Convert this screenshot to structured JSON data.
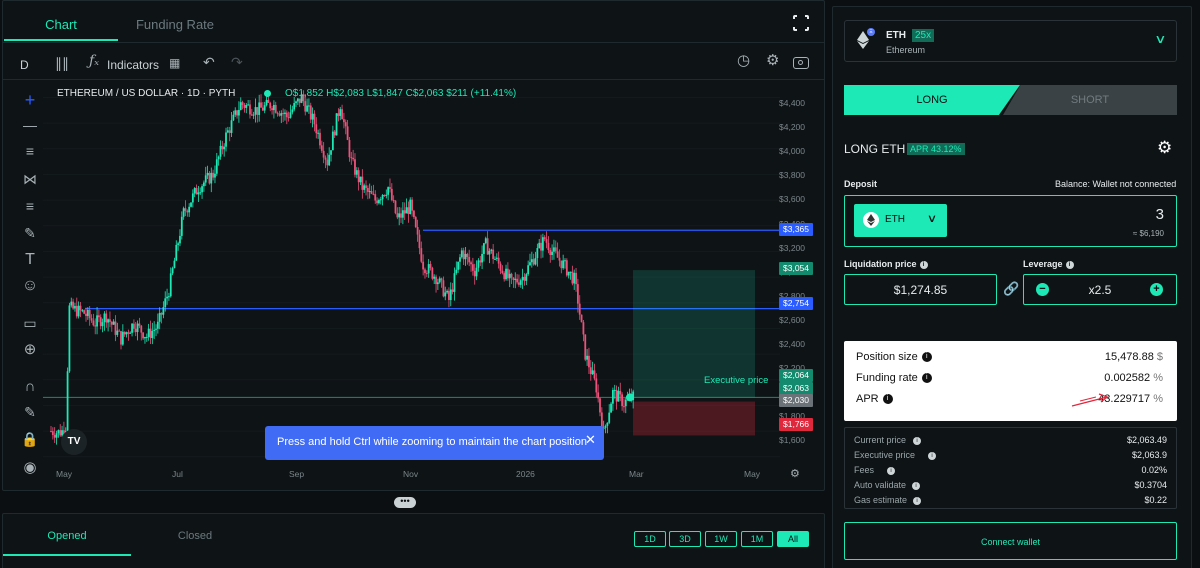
{
  "chart_tabs": [
    "Chart",
    "Funding Rate"
  ],
  "toolbar": {
    "interval": "D",
    "indicators_label": "Indicators"
  },
  "legend": {
    "symbol": "ETHEREUM / US DOLLAR · 1D · PYTH",
    "ohlc": "O$1,852 H$2,083 L$1,847 C$2,063 $211 (+11.41%)"
  },
  "price_axis": [
    "$4,400",
    "$4,200",
    "$4,000",
    "$3,800",
    "$3,600",
    "$3,400",
    "$3,200",
    "$3,000",
    "$2,800",
    "$2,600",
    "$2,400",
    "$2,200",
    "$2,000",
    "$1,800",
    "$1,600"
  ],
  "price_tags": [
    {
      "text": "$3,365",
      "color": "#2a5cff"
    },
    {
      "text": "$3,054",
      "color": "#138a6d"
    },
    {
      "text": "$2,754",
      "color": "#2a5cff"
    },
    {
      "text": "$2,064",
      "color": "#138a6d"
    },
    {
      "text": "$2,063",
      "color": "#138a6d"
    },
    {
      "text": "$2,030",
      "color": "#6b7378"
    },
    {
      "text": "$1,766",
      "color": "#e0283c"
    }
  ],
  "x_axis": [
    "May",
    "Jul",
    "Sep",
    "Nov",
    "2026",
    "Mar",
    "May"
  ],
  "executive_price_label": "Executive price",
  "tooltip": "Press and hold Ctrl while zooming to maintain the chart position",
  "bottom": {
    "tabs": [
      "Opened",
      "Closed"
    ],
    "ranges": [
      "1D",
      "3D",
      "1W",
      "1M",
      "All"
    ],
    "active_range": "All"
  },
  "asset": {
    "symbol": "ETH",
    "leverage_badge": "25x",
    "name": "Ethereum"
  },
  "side_tabs": {
    "long": "LONG",
    "short": "SHORT"
  },
  "position_title": "LONG ETH",
  "apr_badge": "APR 43.12%",
  "deposit": {
    "label": "Deposit",
    "balance": "Balance: Wallet not connected",
    "token": "ETH",
    "amount": "3",
    "usd": "≈ $6,190"
  },
  "liquidation": {
    "label": "Liquidation price",
    "value": "$1,274.85"
  },
  "leverage": {
    "label": "Leverage",
    "value": "x2.5"
  },
  "summary": [
    {
      "label": "Position size",
      "value": "15,478.88",
      "unit": "$"
    },
    {
      "label": "Funding rate",
      "value": "0.002582",
      "unit": "%"
    },
    {
      "label": "APR",
      "value": "43.229717",
      "unit": "%"
    }
  ],
  "details": [
    {
      "label": "Current price",
      "value": "$2,063.49"
    },
    {
      "label": "Executive price",
      "value": "$2,063.9"
    },
    {
      "label": "Fees",
      "value": "0.02%"
    },
    {
      "label": "Auto validate",
      "value": "$0.3704"
    },
    {
      "label": "Gas estimate",
      "value": "$0.22"
    }
  ],
  "connect_wallet": "Connect wallet",
  "colors": {
    "accent": "#1de9b6",
    "bull": "#1de9b6",
    "bear": "#f0517a",
    "line": "#2a5cff",
    "bg": "#0b0f12"
  },
  "chart_data": {
    "type": "candlestick",
    "title": "ETHEREUM / US DOLLAR · 1D · PYTH",
    "y_ticks": [
      4400,
      4200,
      4000,
      3800,
      3600,
      3400,
      3200,
      3000,
      2800,
      2600,
      2400,
      2200,
      2000,
      1800,
      1600
    ],
    "x_ticks": [
      "May",
      "Jul",
      "Sep",
      "Nov",
      "2026",
      "Mar",
      "May"
    ],
    "ylim": [
      1520,
      4520
    ],
    "anchors": [
      [
        0,
        1800
      ],
      [
        4,
        1790
      ],
      [
        6,
        1800
      ],
      [
        8,
        1840
      ],
      [
        10,
        2760
      ],
      [
        18,
        2720
      ],
      [
        24,
        2640
      ],
      [
        30,
        2700
      ],
      [
        38,
        2520
      ],
      [
        45,
        2640
      ],
      [
        52,
        2540
      ],
      [
        58,
        2620
      ],
      [
        64,
        2900
      ],
      [
        72,
        3500
      ],
      [
        80,
        3700
      ],
      [
        88,
        3800
      ],
      [
        95,
        4100
      ],
      [
        103,
        4350
      ],
      [
        112,
        4300
      ],
      [
        120,
        4350
      ],
      [
        128,
        4250
      ],
      [
        136,
        4400
      ],
      [
        143,
        4200
      ],
      [
        150,
        3900
      ],
      [
        157,
        4350
      ],
      [
        163,
        3900
      ],
      [
        169,
        3700
      ],
      [
        176,
        3600
      ],
      [
        183,
        3700
      ],
      [
        188,
        3450
      ],
      [
        195,
        3550
      ],
      [
        202,
        3100
      ],
      [
        209,
        3000
      ],
      [
        216,
        2820
      ],
      [
        223,
        3200
      ],
      [
        230,
        3050
      ],
      [
        236,
        3250
      ],
      [
        243,
        3100
      ],
      [
        250,
        2950
      ],
      [
        256,
        3000
      ],
      [
        262,
        3150
      ],
      [
        268,
        3300
      ],
      [
        272,
        3200
      ],
      [
        278,
        3100
      ],
      [
        284,
        2980
      ],
      [
        286,
        2820
      ],
      [
        290,
        2400
      ],
      [
        296,
        2140
      ],
      [
        300,
        1780
      ],
      [
        305,
        2100
      ],
      [
        311,
        2020
      ],
      [
        316,
        2063
      ]
    ],
    "hlines": [
      {
        "price": 3365,
        "color": "#2a5cff"
      },
      {
        "price": 2754,
        "color": "#2a5cff"
      }
    ]
  }
}
